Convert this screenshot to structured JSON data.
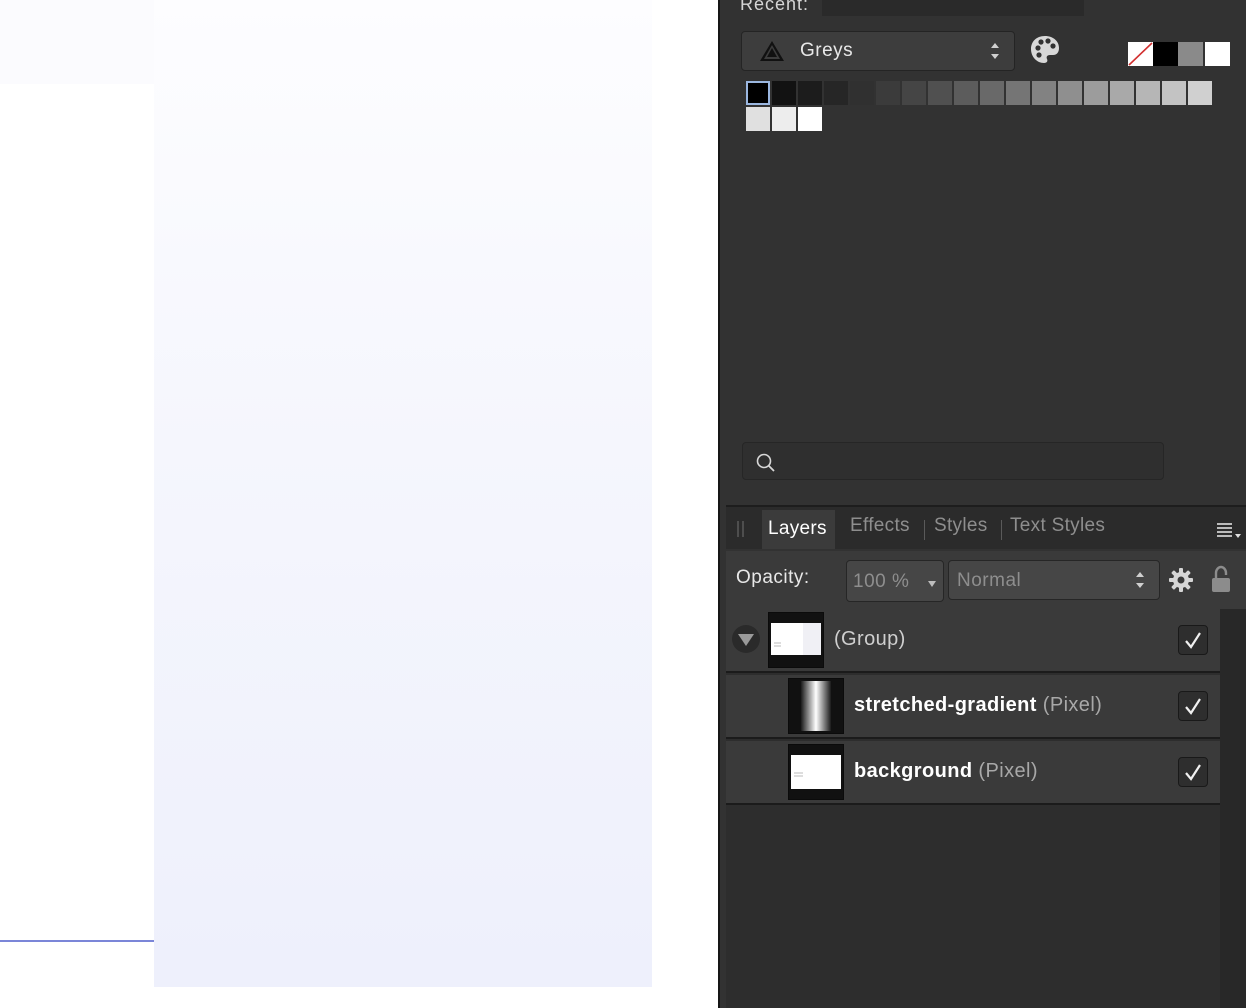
{
  "recent": {
    "label": "Recent:"
  },
  "palette": {
    "name": "Greys",
    "swatches": [
      "#000000",
      "#121212",
      "#1c1c1c",
      "#262626",
      "#303030",
      "#3b3b3b",
      "#454545",
      "#505050",
      "#5c5c5c",
      "#696969",
      "#757575",
      "#828282",
      "#8f8f8f",
      "#9c9c9c",
      "#a9a9a9",
      "#b6b6b6",
      "#c3c3c3",
      "#d0d0d0",
      "#e0e0e0",
      "#ededed",
      "#ffffff"
    ],
    "selected_index": 0
  },
  "fill_swatches": {
    "none": "#ffffff",
    "black": "#000000",
    "grey": "#8a8a8a",
    "white": "#ffffff"
  },
  "search": {
    "placeholder": ""
  },
  "tabs": [
    {
      "label": "Layers",
      "active": true
    },
    {
      "label": "Effects",
      "active": false
    },
    {
      "label": "Styles",
      "active": false
    },
    {
      "label": "Text Styles",
      "active": false
    }
  ],
  "opacity": {
    "label": "Opacity:",
    "value": "100 %"
  },
  "blend_mode": {
    "value": "Normal"
  },
  "layers": [
    {
      "name": "(Group)",
      "type": "",
      "visible": true,
      "expanded": true
    },
    {
      "name": "stretched-gradient",
      "type": "(Pixel)",
      "visible": true
    },
    {
      "name": "background",
      "type": "(Pixel)",
      "visible": true
    }
  ],
  "colors": {
    "accent_line": "#7b86d8",
    "panel_bg": "#323232"
  }
}
